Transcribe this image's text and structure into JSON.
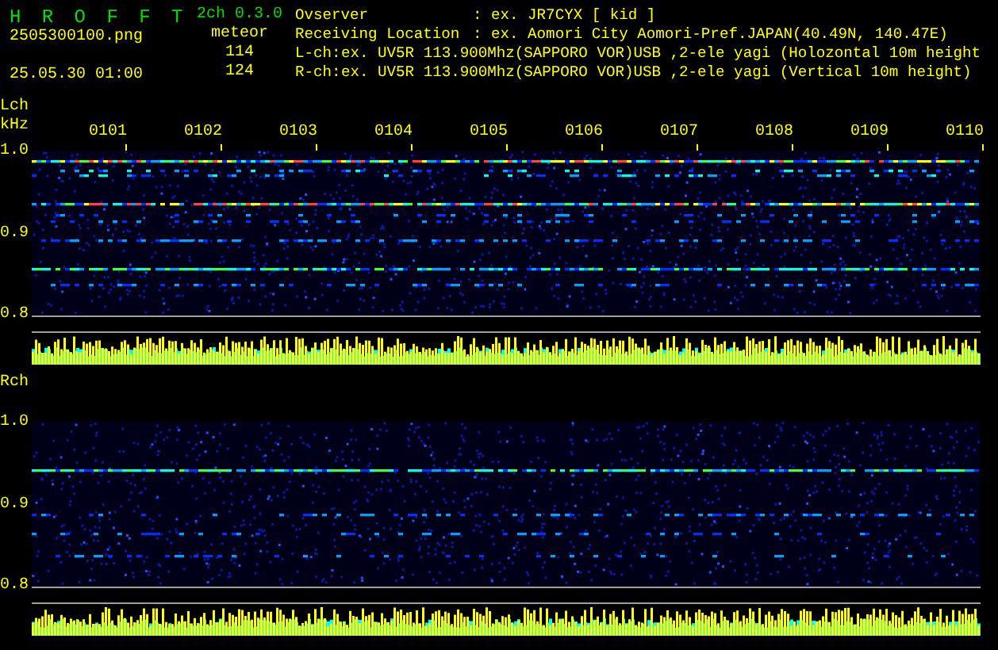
{
  "header": {
    "app_name": "H R O F F T",
    "version": "2ch 0.3.0",
    "file_name": "2505300100.png",
    "date_time": "25.05.30 01:00",
    "meteor_label": "meteor",
    "meteor_counts": [
      "114",
      "124"
    ],
    "info": [
      {
        "label": "Ovserver",
        "value": ": ex. JR7CYX [ kid ]"
      },
      {
        "label": "Receiving Location",
        "value": ": ex. Aomori City Aomori-Pref.JAPAN(40.49N, 140.47E)"
      },
      {
        "label": "L-ch:",
        "value": "ex. UV5R 113.900Mhz(SAPPORO VOR)USB ,2-ele yagi (Holozontal 10m height"
      },
      {
        "label": "R-ch:",
        "value": "ex. UV5R 113.900Mhz(SAPPORO VOR)USB ,2-ele yagi (Vertical 10m height)"
      }
    ]
  },
  "channels": [
    {
      "name": "Lch",
      "unit": "kHz",
      "time_labels": [
        "0101",
        "0102",
        "0103",
        "0104",
        "0105",
        "0106",
        "0107",
        "0108",
        "0109",
        "0110"
      ],
      "y_labels": [
        "1.0",
        "0.9",
        "0.8"
      ]
    },
    {
      "name": "Rch",
      "y_labels": [
        "1.0",
        "0.9",
        "0.8"
      ]
    }
  ]
}
